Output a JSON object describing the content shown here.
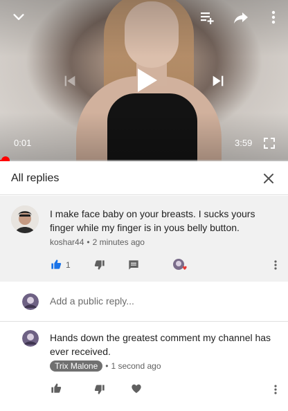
{
  "player": {
    "current_time": "0:01",
    "duration": "3:59",
    "progress": 0.004
  },
  "replies_panel": {
    "title": "All replies"
  },
  "parent_comment": {
    "text": "I make face baby on your breasts.  I sucks yours finger while my finger is in yous belly button.",
    "author": "koshar44",
    "time": "2 minutes ago",
    "like_count": "1"
  },
  "reply_box": {
    "placeholder": "Add a public reply..."
  },
  "reply": {
    "text": "Hands down the greatest comment my channel has ever received.",
    "author": "Trix Malone",
    "time": "1 second ago"
  },
  "colors": {
    "accent": "#ff0000",
    "like_active": "#1a73e8",
    "heart": "#e53935"
  }
}
